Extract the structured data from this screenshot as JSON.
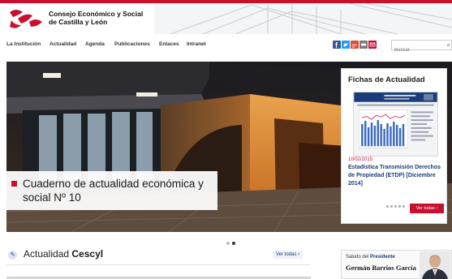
{
  "header": {
    "org_line1": "Consejo Económico y Social",
    "org_line2": "de Castilla y León"
  },
  "nav": {
    "items": [
      "La Institución",
      "Actualidad",
      "Agenda",
      "Publicaciones",
      "Enlaces",
      "Intranet"
    ]
  },
  "social": {
    "icons": [
      "facebook-icon",
      "twitter-icon",
      "google-plus-icon",
      "flickr-icon",
      "mail-icon"
    ],
    "colors": [
      "#3b5998",
      "#1da1f2",
      "#dd4b39",
      "#7a7a7a",
      "#c8102e"
    ]
  },
  "search": {
    "placeholder": "Buscar"
  },
  "hero": {
    "title": "Cuaderno de actualidad económica y social Nº 10",
    "slides": 2,
    "active_slide": 2
  },
  "fichas": {
    "title": "Fichas de Actualidad",
    "date": "10/02/2015",
    "description": "Estadística Transmisión Derechos de Propiedad (ETDP) [Diciembre 2014]",
    "button": "Ver todas",
    "dots": 5
  },
  "actualidad": {
    "title_prefix": "Actualidad ",
    "title_bold": "Cescyl",
    "view_all": "Ver todas"
  },
  "saludo": {
    "prefix": "Saludo del ",
    "role": "Presidente",
    "name": "Germán Barrios García"
  },
  "colors": {
    "accent": "#c8102e",
    "link": "#1a3c7a"
  }
}
